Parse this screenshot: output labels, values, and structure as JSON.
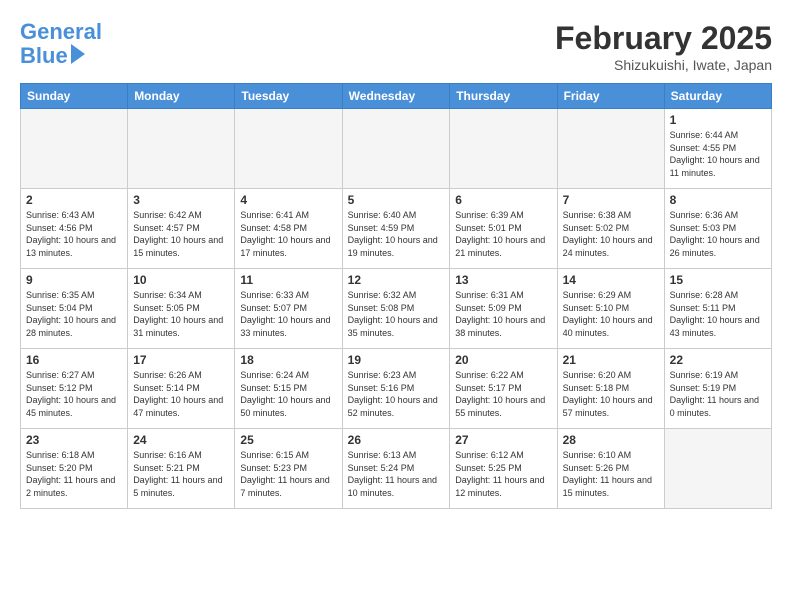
{
  "header": {
    "logo_line1": "General",
    "logo_line2": "Blue",
    "month_title": "February 2025",
    "location": "Shizukuishi, Iwate, Japan"
  },
  "days_of_week": [
    "Sunday",
    "Monday",
    "Tuesday",
    "Wednesday",
    "Thursday",
    "Friday",
    "Saturday"
  ],
  "weeks": [
    [
      {
        "day": "",
        "info": ""
      },
      {
        "day": "",
        "info": ""
      },
      {
        "day": "",
        "info": ""
      },
      {
        "day": "",
        "info": ""
      },
      {
        "day": "",
        "info": ""
      },
      {
        "day": "",
        "info": ""
      },
      {
        "day": "1",
        "info": "Sunrise: 6:44 AM\nSunset: 4:55 PM\nDaylight: 10 hours and 11 minutes."
      }
    ],
    [
      {
        "day": "2",
        "info": "Sunrise: 6:43 AM\nSunset: 4:56 PM\nDaylight: 10 hours and 13 minutes."
      },
      {
        "day": "3",
        "info": "Sunrise: 6:42 AM\nSunset: 4:57 PM\nDaylight: 10 hours and 15 minutes."
      },
      {
        "day": "4",
        "info": "Sunrise: 6:41 AM\nSunset: 4:58 PM\nDaylight: 10 hours and 17 minutes."
      },
      {
        "day": "5",
        "info": "Sunrise: 6:40 AM\nSunset: 4:59 PM\nDaylight: 10 hours and 19 minutes."
      },
      {
        "day": "6",
        "info": "Sunrise: 6:39 AM\nSunset: 5:01 PM\nDaylight: 10 hours and 21 minutes."
      },
      {
        "day": "7",
        "info": "Sunrise: 6:38 AM\nSunset: 5:02 PM\nDaylight: 10 hours and 24 minutes."
      },
      {
        "day": "8",
        "info": "Sunrise: 6:36 AM\nSunset: 5:03 PM\nDaylight: 10 hours and 26 minutes."
      }
    ],
    [
      {
        "day": "9",
        "info": "Sunrise: 6:35 AM\nSunset: 5:04 PM\nDaylight: 10 hours and 28 minutes."
      },
      {
        "day": "10",
        "info": "Sunrise: 6:34 AM\nSunset: 5:05 PM\nDaylight: 10 hours and 31 minutes."
      },
      {
        "day": "11",
        "info": "Sunrise: 6:33 AM\nSunset: 5:07 PM\nDaylight: 10 hours and 33 minutes."
      },
      {
        "day": "12",
        "info": "Sunrise: 6:32 AM\nSunset: 5:08 PM\nDaylight: 10 hours and 35 minutes."
      },
      {
        "day": "13",
        "info": "Sunrise: 6:31 AM\nSunset: 5:09 PM\nDaylight: 10 hours and 38 minutes."
      },
      {
        "day": "14",
        "info": "Sunrise: 6:29 AM\nSunset: 5:10 PM\nDaylight: 10 hours and 40 minutes."
      },
      {
        "day": "15",
        "info": "Sunrise: 6:28 AM\nSunset: 5:11 PM\nDaylight: 10 hours and 43 minutes."
      }
    ],
    [
      {
        "day": "16",
        "info": "Sunrise: 6:27 AM\nSunset: 5:12 PM\nDaylight: 10 hours and 45 minutes."
      },
      {
        "day": "17",
        "info": "Sunrise: 6:26 AM\nSunset: 5:14 PM\nDaylight: 10 hours and 47 minutes."
      },
      {
        "day": "18",
        "info": "Sunrise: 6:24 AM\nSunset: 5:15 PM\nDaylight: 10 hours and 50 minutes."
      },
      {
        "day": "19",
        "info": "Sunrise: 6:23 AM\nSunset: 5:16 PM\nDaylight: 10 hours and 52 minutes."
      },
      {
        "day": "20",
        "info": "Sunrise: 6:22 AM\nSunset: 5:17 PM\nDaylight: 10 hours and 55 minutes."
      },
      {
        "day": "21",
        "info": "Sunrise: 6:20 AM\nSunset: 5:18 PM\nDaylight: 10 hours and 57 minutes."
      },
      {
        "day": "22",
        "info": "Sunrise: 6:19 AM\nSunset: 5:19 PM\nDaylight: 11 hours and 0 minutes."
      }
    ],
    [
      {
        "day": "23",
        "info": "Sunrise: 6:18 AM\nSunset: 5:20 PM\nDaylight: 11 hours and 2 minutes."
      },
      {
        "day": "24",
        "info": "Sunrise: 6:16 AM\nSunset: 5:21 PM\nDaylight: 11 hours and 5 minutes."
      },
      {
        "day": "25",
        "info": "Sunrise: 6:15 AM\nSunset: 5:23 PM\nDaylight: 11 hours and 7 minutes."
      },
      {
        "day": "26",
        "info": "Sunrise: 6:13 AM\nSunset: 5:24 PM\nDaylight: 11 hours and 10 minutes."
      },
      {
        "day": "27",
        "info": "Sunrise: 6:12 AM\nSunset: 5:25 PM\nDaylight: 11 hours and 12 minutes."
      },
      {
        "day": "28",
        "info": "Sunrise: 6:10 AM\nSunset: 5:26 PM\nDaylight: 11 hours and 15 minutes."
      },
      {
        "day": "",
        "info": ""
      }
    ]
  ]
}
